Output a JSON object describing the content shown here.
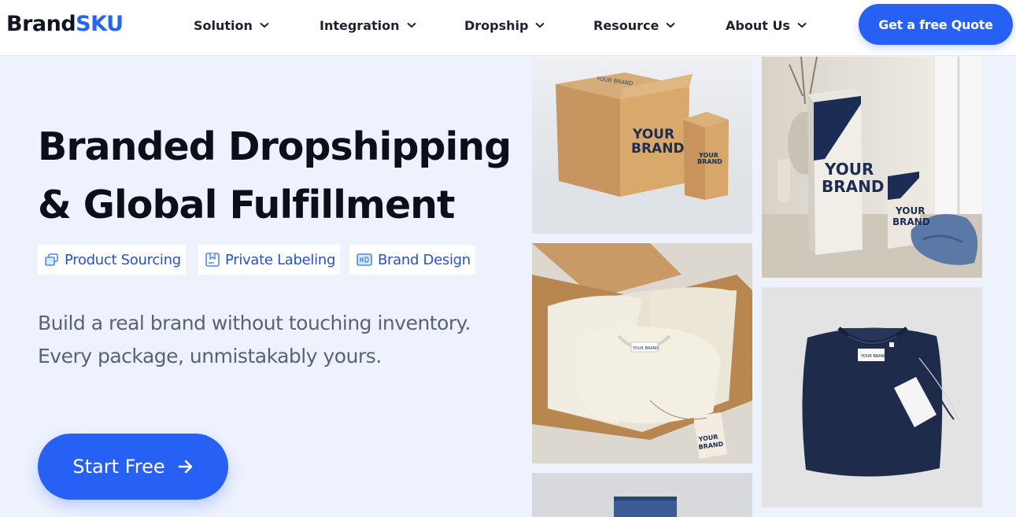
{
  "header": {
    "logo": {
      "part1": "Brand",
      "part2": "SKU"
    },
    "nav": [
      {
        "label": "Solution"
      },
      {
        "label": "Integration"
      },
      {
        "label": "Dropship"
      },
      {
        "label": "Resource"
      },
      {
        "label": "About Us"
      }
    ],
    "cta_label": "Get a free Quote"
  },
  "hero": {
    "title_line1": "Branded Dropshipping",
    "title_line2": "& Global Fulfillment",
    "chips": [
      {
        "label": "Product Sourcing",
        "icon": "sourcing-icon"
      },
      {
        "label": "Private Labeling",
        "icon": "label-icon"
      },
      {
        "label": "Brand Design",
        "icon": "design-icon"
      }
    ],
    "subtitle_line1": "Build a real brand without touching inventory.",
    "subtitle_line2": "Every package, unmistakably yours.",
    "start_label": "Start Free"
  },
  "gallery": {
    "box_text_1": "YOUR",
    "box_text_2": "BRAND",
    "lid_text": "YOUR BRAND",
    "tag_text": "YOUR BRAND"
  },
  "colors": {
    "accent": "#2660f4",
    "brand_blue": "#2763f5",
    "background": "#eef2fc"
  }
}
